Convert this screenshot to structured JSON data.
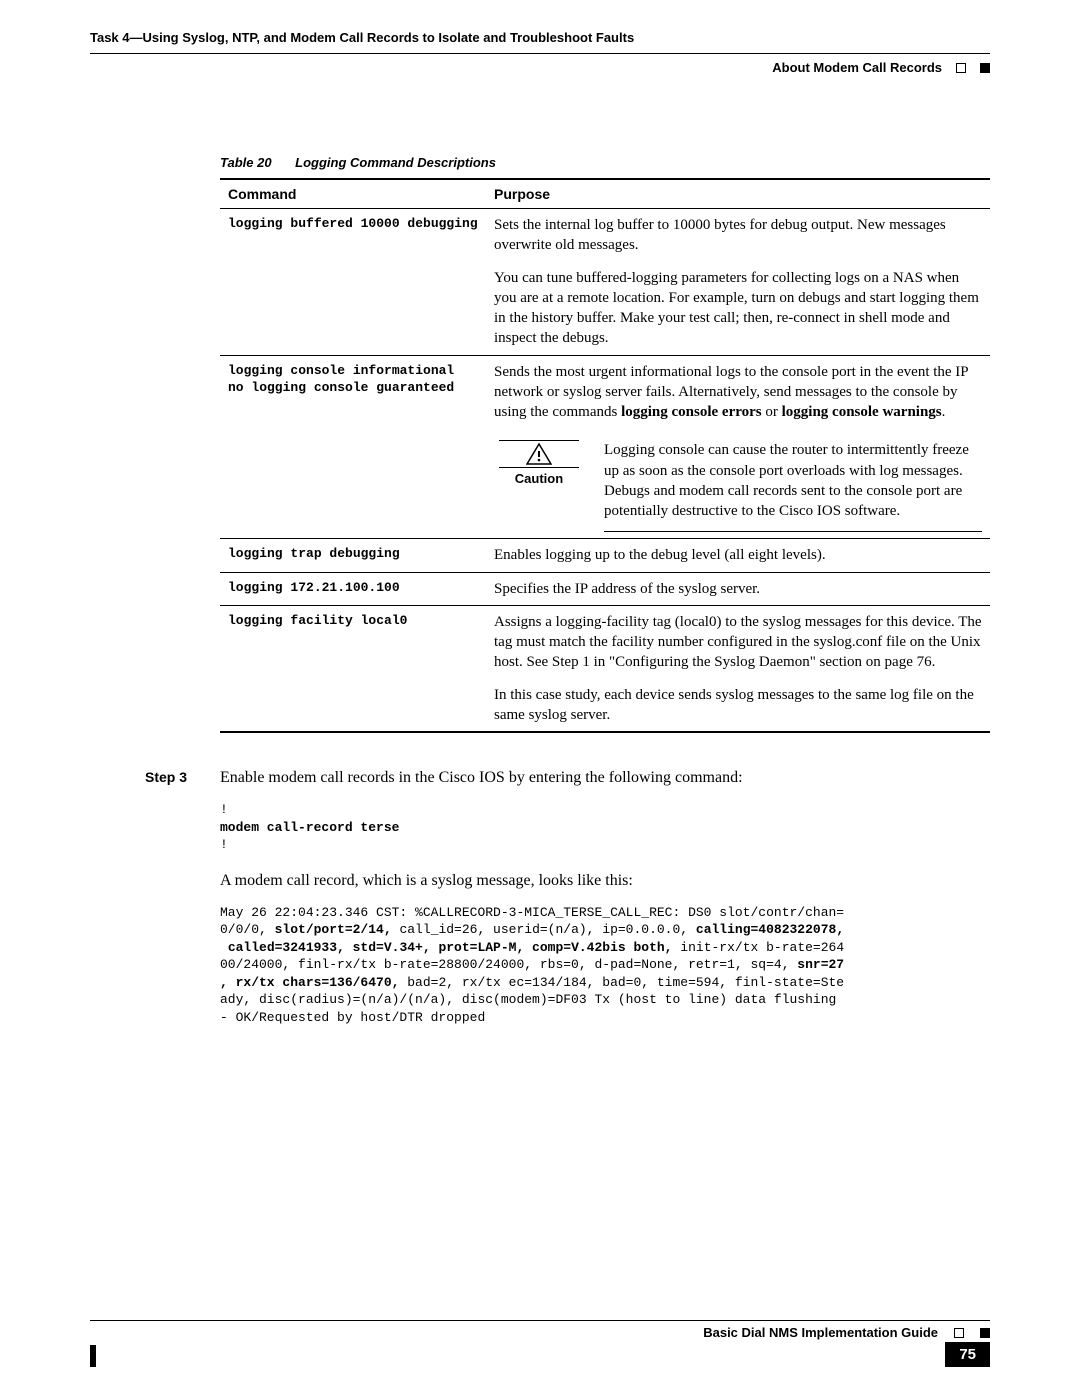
{
  "header": {
    "task": "Task 4—Using Syslog, NTP, and Modem Call Records to Isolate and Troubleshoot Faults",
    "section": "About Modem Call Records"
  },
  "table": {
    "label": "Table 20",
    "title": "Logging Command Descriptions",
    "col1": "Command",
    "col2": "Purpose",
    "rows": [
      {
        "cmd": "logging buffered 10000 debugging",
        "p1": "Sets the internal log buffer to 10000 bytes for debug output. New messages overwrite old messages.",
        "p2": "You can tune buffered-logging parameters for collecting logs on a NAS when you are at a remote location. For example, turn on debugs and start logging them in the history buffer. Make your test call; then, re-connect in shell mode and inspect the debugs."
      },
      {
        "cmd": "logging console informational\nno logging console guaranteed",
        "p1_pre": "Sends the most urgent informational logs to the console port in the event the IP network or syslog server fails. Alternatively, send messages to the console by using the commands ",
        "p1_b1": "logging console errors",
        "p1_mid": " or ",
        "p1_b2": "logging console warnings",
        "p1_post": ".",
        "caution_label": "Caution",
        "caution_text": "Logging console can cause the router to intermittently freeze up as soon as the console port overloads with log messages. Debugs and modem call records sent to the console port are potentially destructive to the Cisco IOS software."
      },
      {
        "cmd": "logging trap debugging",
        "p1": "Enables logging up to the debug level (all eight levels)."
      },
      {
        "cmd": "logging 172.21.100.100",
        "p1": "Specifies the IP address of the syslog server."
      },
      {
        "cmd": "logging facility local0",
        "p1": "Assigns a logging-facility tag (local0) to the syslog messages for this device. The tag must match the facility number configured in the syslog.conf file on the Unix host. See Step 1 in \"Configuring the Syslog Daemon\" section on page 76.",
        "p2": "In this case study, each device sends syslog messages to the same log file on the same syslog server."
      }
    ]
  },
  "step": {
    "label": "Step 3",
    "intro": "Enable modem call records in the Cisco IOS by entering the following command:",
    "code_pre": "!",
    "code_b": "modem call-record terse",
    "code_post": "!",
    "after": "A modem call record, which is a syslog message, looks like this:",
    "log_l1a": "May 26 22:04:23.346 CST: %CALLRECORD-3-MICA_TERSE_CALL_REC: DS0 slot/contr/chan=",
    "log_l2a": "0/0/0, ",
    "log_l2b": "slot/port=2/14,",
    "log_l2c": " call_id=26, userid=(n/a), ip=0.0.0.0, ",
    "log_l2d": "calling=4082322078,",
    "log_l3a": " called=3241933, std=V.34+, prot=LAP-M, comp=V.42bis both,",
    "log_l3b": " init-rx/tx b-rate=264",
    "log_l4a": "00/24000, finl-rx/tx b-rate=28800/24000, rbs=0, d-pad=None, retr=1, sq=4, ",
    "log_l4b": "snr=27",
    "log_l5a": ", rx/tx chars=136/6470,",
    "log_l5b": " bad=2, rx/tx ec=134/184, bad=0, time=594, finl-state=Ste",
    "log_l6": "ady, disc(radius)=(n/a)/(n/a), disc(modem)=DF03 Tx (host to line) data flushing",
    "log_l7": "- OK/Requested by host/DTR dropped"
  },
  "footer": {
    "title": "Basic Dial NMS Implementation Guide",
    "page": "75"
  }
}
